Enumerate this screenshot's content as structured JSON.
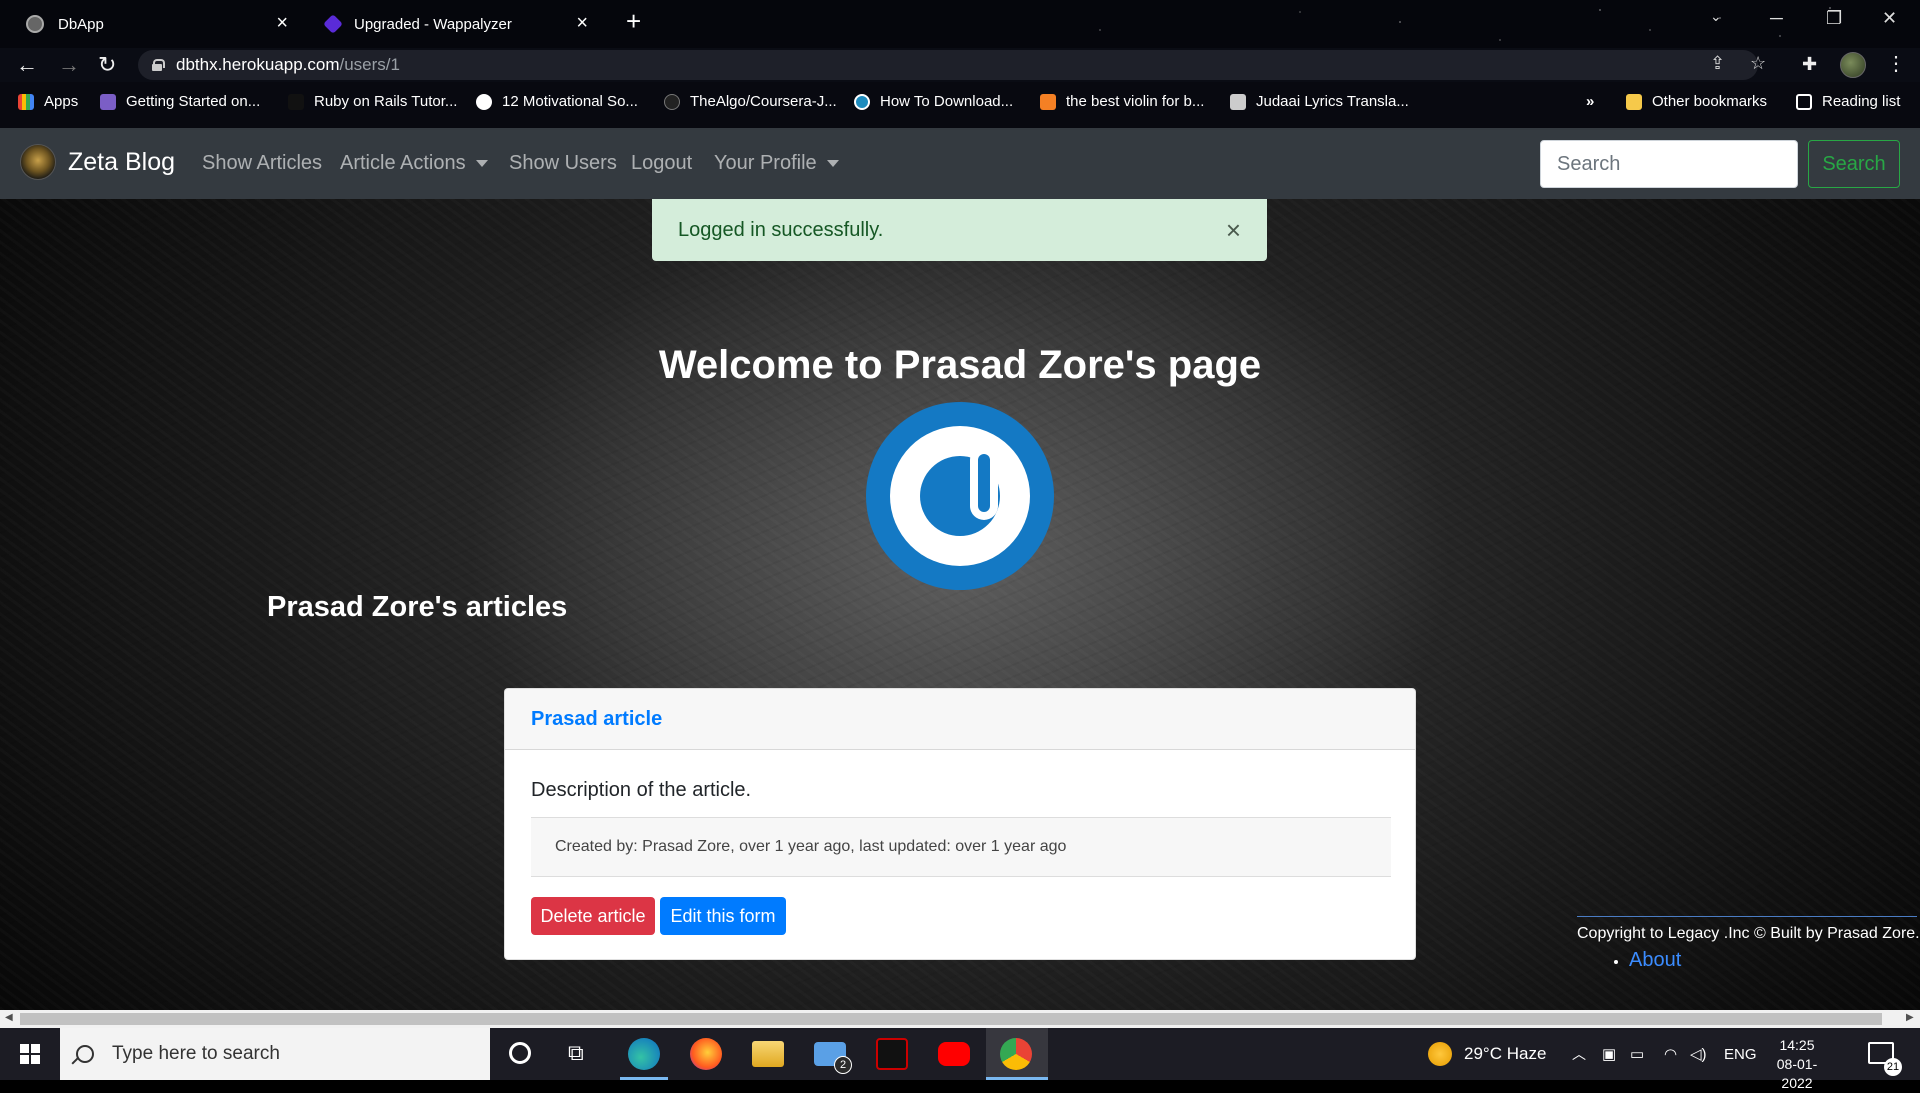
{
  "browser": {
    "tabs": [
      {
        "title": "DbApp",
        "favicon": "globe-icon",
        "close": "×"
      },
      {
        "title": "Upgraded - Wappalyzer",
        "favicon": "wappalyzer-icon",
        "close": "×"
      }
    ],
    "new_tab": "+",
    "url_host": "dbthx.herokuapp.com",
    "url_path": "/users/1",
    "bookmarks": [
      {
        "label": "Apps",
        "icon": "apps-grid-icon",
        "color": "#4285f4"
      },
      {
        "label": "Getting Started on...",
        "icon": "heroku-icon",
        "color": "#7b5ec6"
      },
      {
        "label": "Ruby on Rails Tutor...",
        "icon": "rails-icon",
        "color": "#111111"
      },
      {
        "label": "12 Motivational So...",
        "icon": "globe-icon",
        "color": "#ffffff"
      },
      {
        "label": "TheAlgo/Coursera-J...",
        "icon": "github-icon",
        "color": "#222222"
      },
      {
        "label": "How To Download...",
        "icon": "wordpress-icon",
        "color": "#1e8cbe"
      },
      {
        "label": "the best violin for b...",
        "icon": "stackoverflow-icon",
        "color": "#f48024"
      },
      {
        "label": "Judaai Lyrics Transla...",
        "icon": "lyrics-icon",
        "color": "#cccccc"
      },
      {
        "label": "»",
        "icon": "",
        "color": ""
      },
      {
        "label": "Other bookmarks",
        "icon": "folder-icon",
        "color": "#f6c94a"
      },
      {
        "label": "Reading list",
        "icon": "reading-list-icon",
        "color": "#ffffff"
      }
    ]
  },
  "navbar": {
    "brand": "Zeta Blog",
    "links": [
      "Show Articles",
      "Article Actions",
      "Show Users",
      "Logout",
      "Your Profile"
    ],
    "search_placeholder": "Search",
    "search_button": "Search"
  },
  "alert": {
    "message": "Logged in successfully.",
    "close": "×"
  },
  "profile": {
    "welcome": "Welcome to Prasad Zore's page",
    "articles_heading": "Prasad Zore's articles"
  },
  "article": {
    "title": "Prasad article",
    "description": "Description of the article.",
    "meta": "Created by: Prasad Zore, over 1 year ago, last updated: over 1 year ago",
    "delete_label": "Delete article",
    "edit_label": "Edit this form"
  },
  "footer": {
    "copyright": "Copyright to Legacy .Inc © Built by Prasad Zore.",
    "about": "About"
  },
  "taskbar": {
    "search_placeholder": "Type here to search",
    "mail_badge": "2",
    "weather": "29°C  Haze",
    "language": "ENG",
    "time": "14:25",
    "date": "08-01-2022",
    "notifications": "21"
  }
}
